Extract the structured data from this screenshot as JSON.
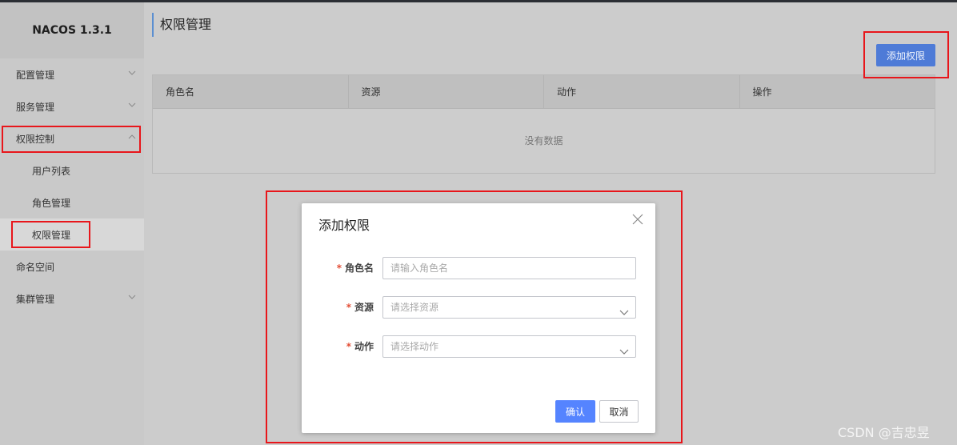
{
  "brand": {
    "title": "NACOS 1.3.1"
  },
  "sidebar": {
    "items": [
      {
        "label": "配置管理",
        "icon": "chevron-down-icon"
      },
      {
        "label": "服务管理",
        "icon": "chevron-down-icon"
      },
      {
        "label": "权限控制",
        "icon": "chevron-up-icon"
      },
      {
        "label": "用户列表"
      },
      {
        "label": "角色管理"
      },
      {
        "label": "权限管理"
      },
      {
        "label": "命名空间"
      },
      {
        "label": "集群管理",
        "icon": "chevron-down-icon"
      }
    ]
  },
  "main": {
    "title": "权限管理",
    "add_button": "添加权限",
    "table": {
      "columns": [
        "角色名",
        "资源",
        "动作",
        "操作"
      ],
      "empty_text": "没有数据"
    }
  },
  "dialog": {
    "title": "添加权限",
    "required_mark": "*",
    "fields": [
      {
        "label": "角色名",
        "placeholder": "请输入角色名"
      },
      {
        "label": "资源",
        "placeholder": "请选择资源"
      },
      {
        "label": "动作",
        "placeholder": "请选择动作"
      }
    ],
    "confirm": "确认",
    "cancel": "取消"
  },
  "watermark": "CSDN @吉忠昱",
  "colors": {
    "accent": "#4e7bd7",
    "primary_button": "#5584ff",
    "highlight": "#e8161b"
  }
}
